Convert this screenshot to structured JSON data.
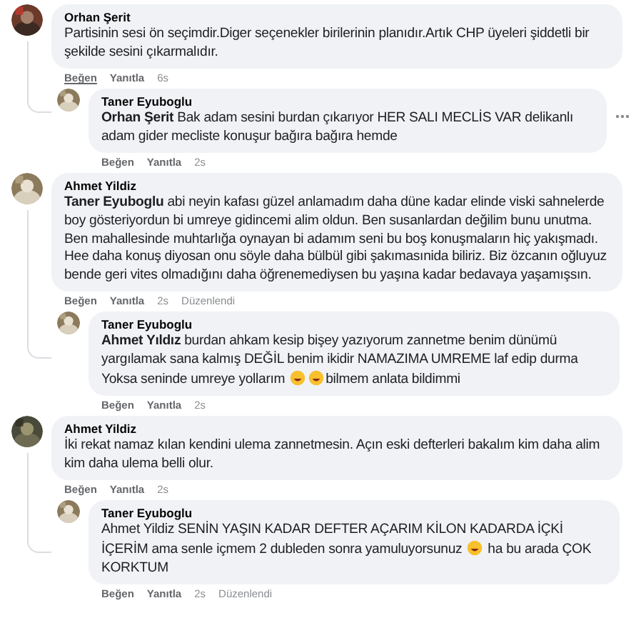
{
  "threads": [
    {
      "comment": {
        "author": "Orhan Şerit",
        "parts": [
          {
            "kind": "text",
            "text": "Partisinin sesi ön seçimdir.Diger seçenekler birilerinin planıdır.Artık CHP üyeleri şiddetli bir şekilde sesini çıkarmalıdır."
          }
        ],
        "actions": [
          {
            "label": "Beğen",
            "hovered": true
          },
          {
            "label": "Yanıtla",
            "hovered": false
          }
        ],
        "time": "6s",
        "more_button": false
      },
      "replies": [
        {
          "author": "Taner Eyuboglu",
          "parts": [
            {
              "kind": "text",
              "text": "**Orhan Şerit** Bak adam sesini burdan çıkarıyor HER SALI MECLİS VAR delikanlı adam gider mecliste konuşur bağıra bağıra hemde"
            }
          ],
          "actions": [
            {
              "label": "Beğen",
              "hovered": false
            },
            {
              "label": "Yanıtla",
              "hovered": false
            }
          ],
          "time": "2s",
          "more_button": true
        }
      ]
    },
    {
      "comment": {
        "author": "Ahmet Yildiz",
        "parts": [
          {
            "kind": "text",
            "text": "**Taner Eyuboglu** abi neyin kafası güzel anlamadım daha düne kadar elinde viski sahnelerde boy gösteriyordun bi umreye gidincemi alim oldun. Ben susanlardan değilim bunu unutma. Ben mahallesinde muhtarlığa oynayan bi adamım seni bu boş konuşmaların hiç yakışmadı. Hee daha konuş diyosan onu söyle daha bülbül gibi şakımasınida biliriz. Biz özcanın oğluyuz bende geri vites olmadığını daha öğrenemediysen bu yaşına kadar bedavaya yaşamışsın."
          }
        ],
        "actions": [
          {
            "label": "Beğen",
            "hovered": false
          },
          {
            "label": "Yanıtla",
            "hovered": false
          }
        ],
        "time": "2s",
        "edited": "Düzenlendi",
        "more_button": false
      },
      "replies": [
        {
          "author": "Taner Eyuboglu",
          "parts": [
            {
              "kind": "text",
              "text": "**Ahmet Yıldız** burdan ahkam kesip bişey yazıyorum zannetme benim dünümü yargılamak sana kalmış DEĞİL benim ikidir NAMAZIMA UMREME laf edip durma Yoksa seninde umreye yollarım "
            },
            {
              "kind": "emoji"
            },
            {
              "kind": "emoji"
            },
            {
              "kind": "text",
              "text": "bilmem anlata bildimmi"
            }
          ],
          "actions": [
            {
              "label": "Beğen",
              "hovered": false
            },
            {
              "label": "Yanıtla",
              "hovered": false
            }
          ],
          "time": "2s",
          "more_button": false
        }
      ]
    },
    {
      "comment": {
        "author": "Ahmet Yildiz",
        "parts": [
          {
            "kind": "text",
            "text": "İki rekat namaz kılan kendini ulema zannetmesin. Açın eski defterleri bakalım kim daha alim kim daha ulema belli olur."
          }
        ],
        "actions": [
          {
            "label": "Beğen",
            "hovered": false
          },
          {
            "label": "Yanıtla",
            "hovered": false
          }
        ],
        "time": "2s",
        "more_button": false
      },
      "replies": [
        {
          "author": "Taner Eyuboglu",
          "parts": [
            {
              "kind": "text",
              "text": "Ahmet Yildiz SENİN YAŞIN KADAR DEFTER AÇARIM KİLON KADARDA İÇKİ İÇERİM ama senle içmem 2 dubleden sonra yamuluyorsunuz "
            },
            {
              "kind": "emoji"
            },
            {
              "kind": "text",
              "text": " ha bu arada ÇOK KORKTUM"
            }
          ],
          "actions": [
            {
              "label": "Beğen",
              "hovered": false
            },
            {
              "label": "Yanıtla",
              "hovered": false
            }
          ],
          "time": "2s",
          "edited": "Düzenlendi",
          "more_button": false
        }
      ]
    }
  ]
}
